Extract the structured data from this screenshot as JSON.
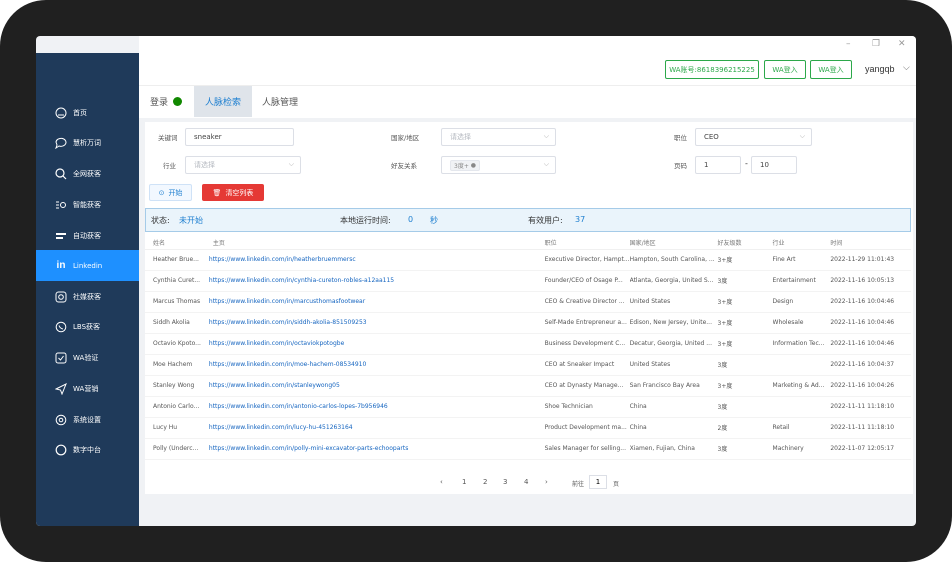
{
  "window": {
    "minimize": "–",
    "restore": "❐",
    "close": "✕"
  },
  "header": {
    "wa_account_label": "WA账号:8618396215225",
    "wa_login_1": "WA登入",
    "wa_login_2": "WA登入",
    "username": "yangqb"
  },
  "sidebar": {
    "items": [
      {
        "label": "首页",
        "icon": "home-icon"
      },
      {
        "label": "慧析万词",
        "icon": "chat-icon"
      },
      {
        "label": "全网获客",
        "icon": "search-icon"
      },
      {
        "label": "智能获客",
        "icon": "smart-search-icon"
      },
      {
        "label": "自动获客",
        "icon": "list-icon"
      },
      {
        "label": "Linkedin",
        "icon": "linkedin-icon"
      },
      {
        "label": "社媒获客",
        "icon": "instagram-icon"
      },
      {
        "label": "LBS获客",
        "icon": "whatsapp-icon"
      },
      {
        "label": "WA验证",
        "icon": "check-icon"
      },
      {
        "label": "WA营销",
        "icon": "send-icon"
      },
      {
        "label": "系统设置",
        "icon": "settings-icon"
      },
      {
        "label": "数字中台",
        "icon": "circle-icon"
      }
    ]
  },
  "tabs": {
    "login_label": "登录",
    "search_tab": "人脉检索",
    "manage_tab": "人脉管理"
  },
  "form": {
    "keyword_label": "关键词",
    "keyword_value": "sneaker",
    "country_label": "国家/地区",
    "country_placeholder": "请选择",
    "title_label": "职位",
    "title_value": "CEO",
    "industry_label": "行业",
    "industry_placeholder": "请选择",
    "relation_label": "好友关系",
    "relation_tag": "3度+",
    "pages_label": "页码",
    "page_from": "1",
    "page_sep": "-",
    "page_to": "10",
    "start_button": "开始",
    "clear_button": "清空列表"
  },
  "status": {
    "state_label": "状态:",
    "state_value": "未开始",
    "runtime_label": "本地运行时间:",
    "runtime_value": "0",
    "runtime_unit": "秒",
    "users_label": "有效用户:",
    "users_value": "37"
  },
  "table": {
    "columns": [
      "姓名",
      "主页",
      "职位",
      "国家/地区",
      "好友级数",
      "行业",
      "时间"
    ],
    "rows": [
      [
        "Heather Brue...",
        "https://www.linkedin.com/in/heatherbruemmersc",
        "Executive Director, Hampt...",
        "Hampton, South Carolina, ...",
        "3+度",
        "Fine Art",
        "2022-11-29 11:01:43"
      ],
      [
        "Cynthia Curet...",
        "https://www.linkedin.com/in/cynthia-cureton-robles-a12aa115",
        "Founder/CEO of Osage P...",
        "Atlanta, Georgia, United S...",
        "3度",
        "Entertainment",
        "2022-11-16 10:05:13"
      ],
      [
        "Marcus Thomas",
        "https://www.linkedin.com/in/marcusthomasfootwear",
        "CEO & Creative Director ...",
        "United States",
        "3+度",
        "Design",
        "2022-11-16 10:04:46"
      ],
      [
        "Siddh Akolia",
        "https://www.linkedin.com/in/siddh-akolia-851509253",
        "Self-Made Entrepreneur a...",
        "Edison, New Jersey, Unite...",
        "3+度",
        "Wholesale",
        "2022-11-16 10:04:46"
      ],
      [
        "Octavio Kpoto...",
        "https://www.linkedin.com/in/octaviokpotogbe",
        "Business Development C...",
        "Decatur, Georgia, United ...",
        "3+度",
        "Information Tec...",
        "2022-11-16 10:04:46"
      ],
      [
        "Moe Hachem",
        "https://www.linkedin.com/in/moe-hachem-08534910",
        "CEO at Sneaker Impact",
        "United States",
        "3度",
        "",
        "2022-11-16 10:04:37"
      ],
      [
        "Stanley Wong",
        "https://www.linkedin.com/in/stanleywong05",
        "CEO at Dynasty Manage...",
        "San Francisco Bay Area",
        "3+度",
        "Marketing & Ad...",
        "2022-11-16 10:04:26"
      ],
      [
        "Antonio Carlo...",
        "https://www.linkedin.com/in/antonio-carlos-lopes-7b956946",
        "Shoe Technician",
        "China",
        "3度",
        "",
        "2022-11-11 11:18:10"
      ],
      [
        "Lucy Hu",
        "https://www.linkedin.com/in/lucy-hu-451263164",
        "Product Development ma...",
        "China",
        "2度",
        "Retail",
        "2022-11-11 11:18:10"
      ],
      [
        "Polly (Underc...",
        "https://www.linkedin.com/in/polly-mini-excavator-parts-echooparts",
        "Sales Manager for selling...",
        "Xiamen, Fujian, China",
        "3度",
        "Machinery",
        "2022-11-07 12:05:17"
      ]
    ]
  },
  "pagination": {
    "prev": "‹",
    "pages": [
      "1",
      "2",
      "3",
      "4"
    ],
    "next": "›",
    "goto_label": "前往",
    "goto_value": "1",
    "goto_unit": "页"
  }
}
